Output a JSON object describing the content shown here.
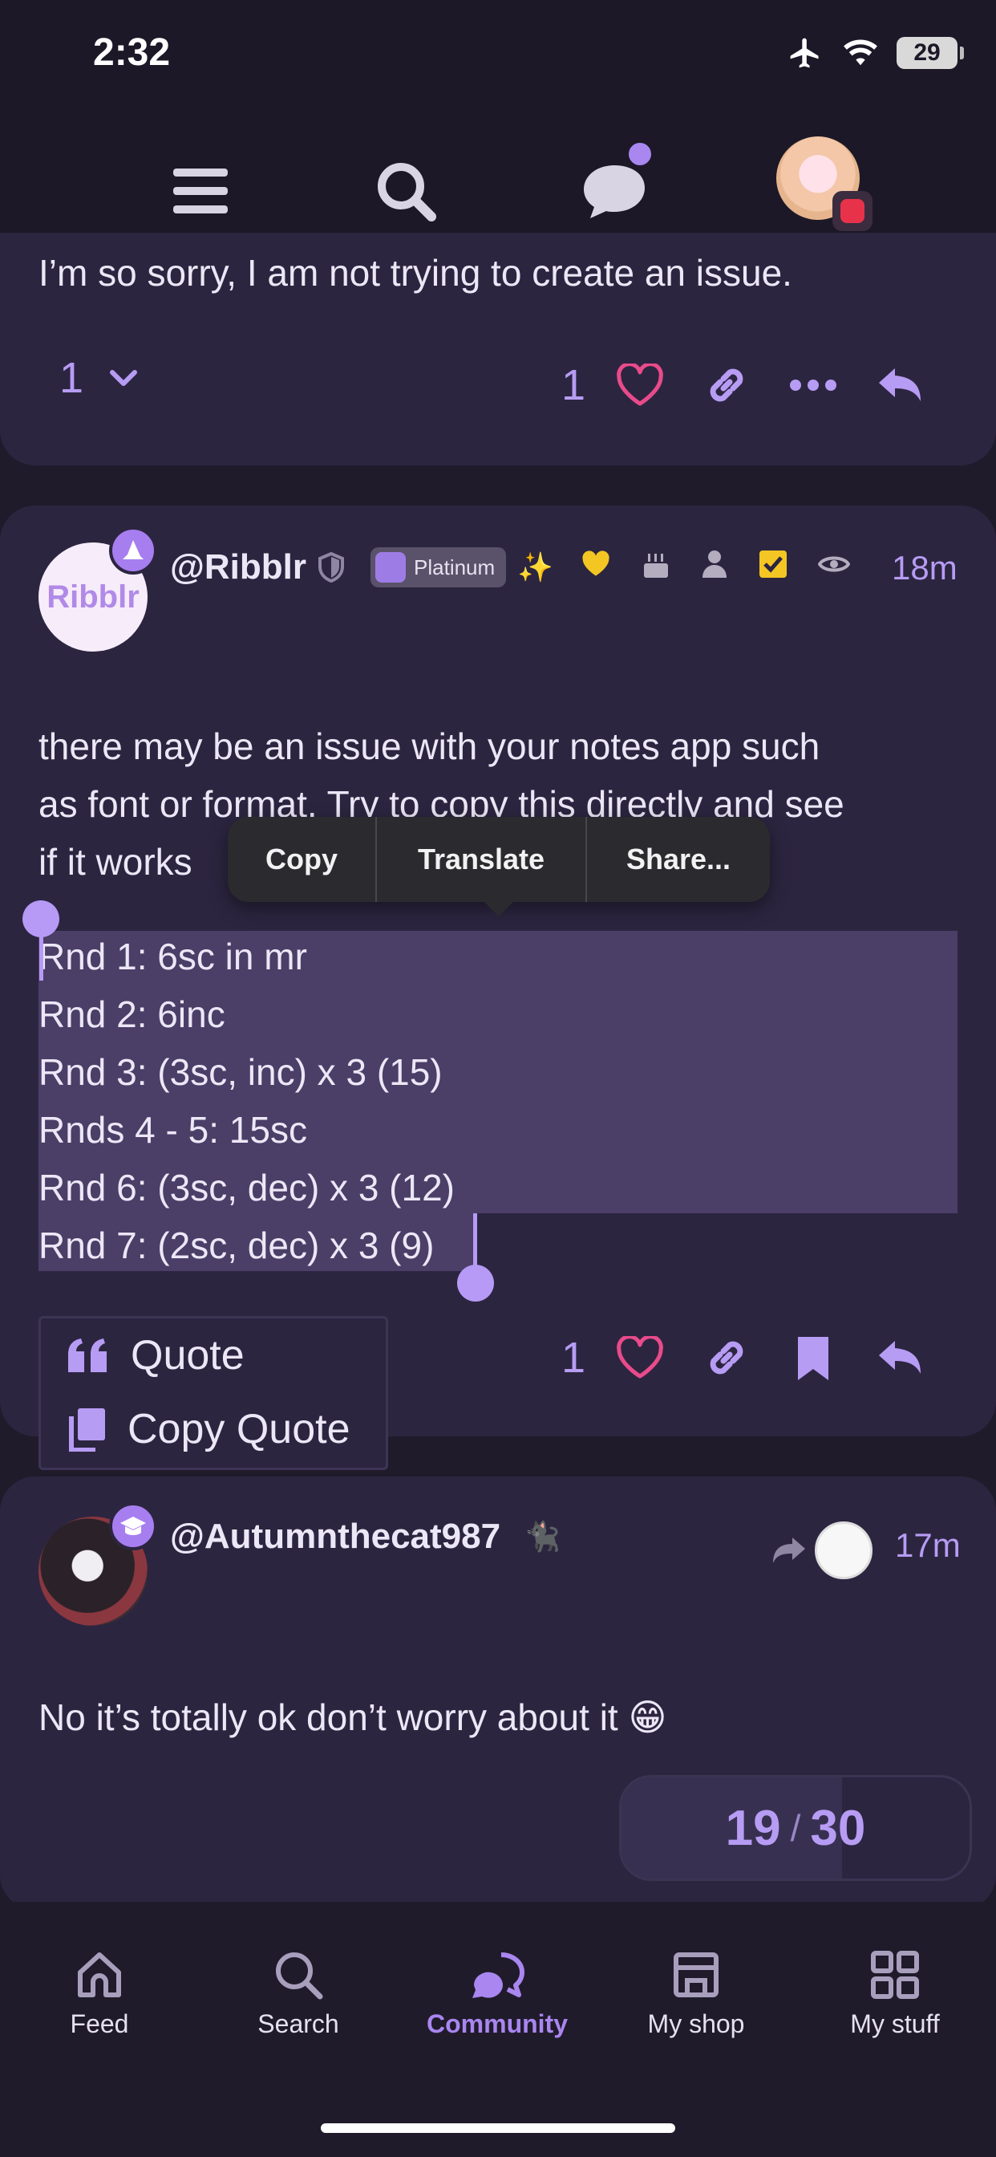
{
  "status_bar": {
    "time": "2:32",
    "battery": "29"
  },
  "post1": {
    "text": "I’m so sorry, I am not trying to create an issue.",
    "vote_count": "1",
    "like_count": "1"
  },
  "post2": {
    "avatar_text": "Ribblr",
    "username": "@Ribblr",
    "plan_badge": "Platinum",
    "time": "18m",
    "text_lines": [
      "there may be an issue with your notes app such",
      "as font or format. Try to copy this directly and see",
      "if it works"
    ],
    "selected_lines": [
      "Rnd 1: 6sc in mr",
      "Rnd 2: 6inc",
      "Rnd 3: (3sc, inc) x 3 (15)",
      "Rnds 4 - 5: 15sc",
      "Rnd 6: (3sc, dec) x 3 (12)",
      "Rnd 7: (2sc, dec) x 3 (9)"
    ],
    "like_count": "1"
  },
  "context_menu": {
    "items": [
      "Copy",
      "Translate",
      "Share..."
    ]
  },
  "quote_menu": {
    "quote": "Quote",
    "copy_quote": "Copy Quote"
  },
  "post3": {
    "username": "@Autumnthecat987",
    "time": "17m",
    "text": "No it’s totally ok don’t worry about it 😁"
  },
  "progress": {
    "current": "19",
    "total": "30",
    "fraction": 0.6333
  },
  "bottom_nav": {
    "tabs": [
      "Feed",
      "Search",
      "Community",
      "My shop",
      "My stuff"
    ],
    "active": "Community"
  },
  "colors": {
    "accent": "#a986f0",
    "heart": "#e94b8a",
    "background": "#201b2b",
    "card": "#2c2540",
    "selection": "#4b3e67"
  }
}
